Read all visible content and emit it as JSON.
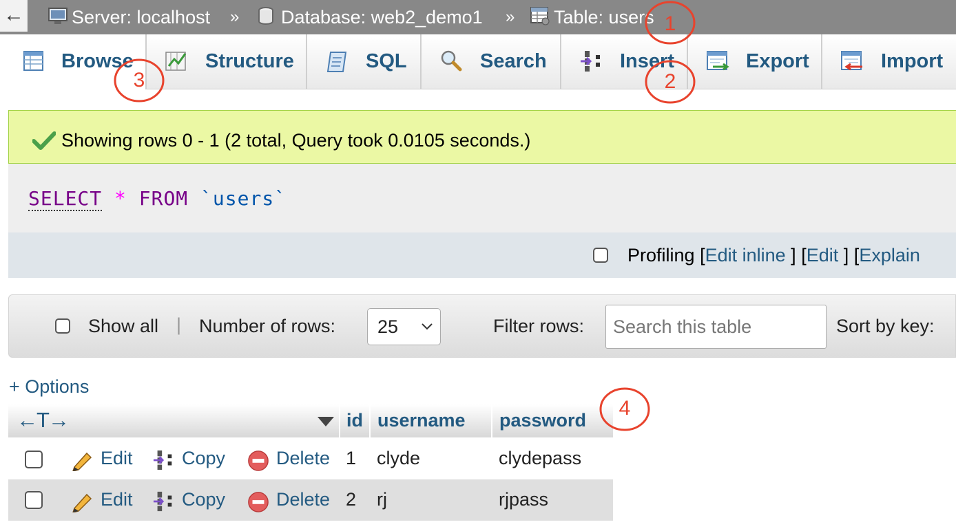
{
  "breadcrumb": {
    "back_label": "←",
    "server": "Server: localhost",
    "database": "Database: web2_demo1",
    "table": "Table: users",
    "separator": "»"
  },
  "tabs": [
    {
      "label": "Browse",
      "icon": "browse-icon",
      "active": true
    },
    {
      "label": "Structure",
      "icon": "structure-icon"
    },
    {
      "label": "SQL",
      "icon": "sql-icon"
    },
    {
      "label": "Search",
      "icon": "search-icon"
    },
    {
      "label": "Insert",
      "icon": "insert-icon"
    },
    {
      "label": "Export",
      "icon": "export-icon"
    },
    {
      "label": "Import",
      "icon": "import-icon"
    }
  ],
  "message": {
    "text": "Showing rows 0 - 1 (2 total, Query took 0.0105 seconds.)",
    "icon": "check-icon",
    "color": "#ebf8a4"
  },
  "query": {
    "select": "SELECT",
    "star": "*",
    "from": "FROM",
    "table": "`users`"
  },
  "profiling": {
    "label": "Profiling",
    "open_bracket": "[",
    "close_bracket": "]",
    "edit_inline": "Edit inline",
    "edit": "Edit",
    "explain": "Explain"
  },
  "navigation": {
    "show_all": "Show all",
    "divider": "|",
    "rows_label": "Number of rows:",
    "rows_value": "25",
    "filter_label": "Filter rows:",
    "filter_placeholder": "Search this table",
    "sort_label": "Sort by key:"
  },
  "options_label": "+ Options",
  "table": {
    "arrows": "←T→",
    "columns": [
      "id",
      "username",
      "password"
    ],
    "action_labels": {
      "edit": "Edit",
      "copy": "Copy",
      "delete": "Delete"
    },
    "rows": [
      {
        "id": "1",
        "username": "clyde",
        "password": "clydepass"
      },
      {
        "id": "2",
        "username": "rj",
        "password": "rjpass"
      }
    ]
  },
  "annotations": [
    "1",
    "2",
    "3",
    "4"
  ],
  "colors": {
    "link": "#235a81",
    "topbar": "#888888",
    "annotation": "#e8432d",
    "keyword": "#770088"
  }
}
